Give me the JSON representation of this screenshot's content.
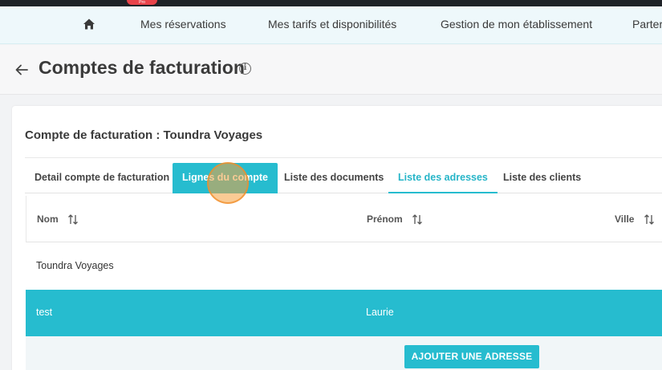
{
  "top_badge": "Pro",
  "nav": {
    "home_icon": "home-icon",
    "items": [
      "Mes réservations",
      "Mes tarifs et disponibilités",
      "Gestion de mon établissement",
      "Parter"
    ]
  },
  "page": {
    "title": "Comptes de facturation",
    "info_glyph": "i"
  },
  "card": {
    "title": "Compte de facturation : Toundra Voyages"
  },
  "tabs": [
    "Detail compte de facturation",
    "Lignes du compte",
    "Liste des documents",
    "Liste des adresses",
    "Liste des clients"
  ],
  "active_tab": "Liste des adresses",
  "hovered_tab": "Lignes du compte",
  "table": {
    "columns": [
      "Nom",
      "Prénom",
      "Ville"
    ],
    "rows": [
      {
        "nom": "Toundra Voyages",
        "prenom": "",
        "ville": ""
      },
      {
        "nom": "test",
        "prenom": "Laurie",
        "ville": ""
      }
    ]
  },
  "add_button_label": "AJOUTER UNE ADRESSE",
  "colors": {
    "accent": "#26bccf",
    "nav_bg": "#eef8fb",
    "click_marker": "#f5a03c"
  }
}
